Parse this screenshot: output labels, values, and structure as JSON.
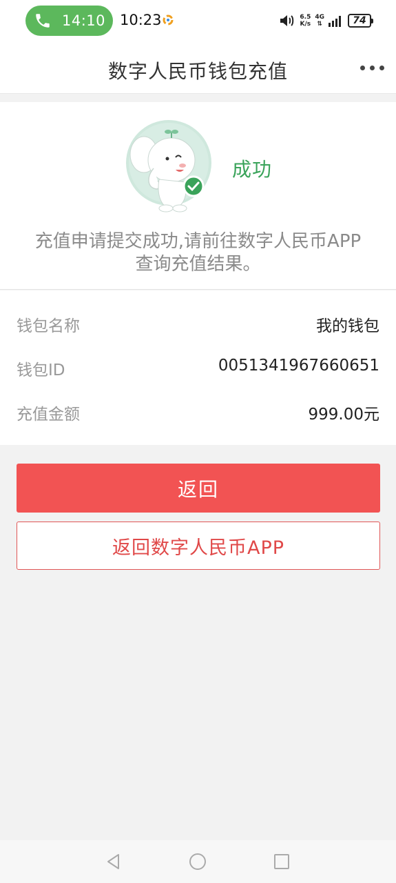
{
  "status_bar": {
    "call_time": "14:10",
    "clock": "10:23",
    "net_speed_top": "6.5",
    "net_speed_bottom": "K/s",
    "network": "4G",
    "battery": "74"
  },
  "header": {
    "title": "数字人民币钱包充值"
  },
  "result": {
    "status": "成功",
    "message_line1": "充值申请提交成功,请前往数字人民币APP",
    "message_line2": "查询充值结果。"
  },
  "details": [
    {
      "label": "钱包名称",
      "value": "我的钱包"
    },
    {
      "label": "钱包ID",
      "value": "0051341967660651"
    },
    {
      "label": "充值金额",
      "value": "999.00元"
    }
  ],
  "actions": {
    "back_label": "返回",
    "back_to_app_label": "返回数字人民币APP"
  },
  "colors": {
    "primary": "#f25353",
    "success": "#3aa35a",
    "call_pill": "#5cb85c"
  },
  "icons": [
    "phone-icon",
    "more-icon",
    "mascot-elephant",
    "check-badge-icon",
    "back-triangle-icon",
    "home-circle-icon",
    "recents-square-icon"
  ]
}
